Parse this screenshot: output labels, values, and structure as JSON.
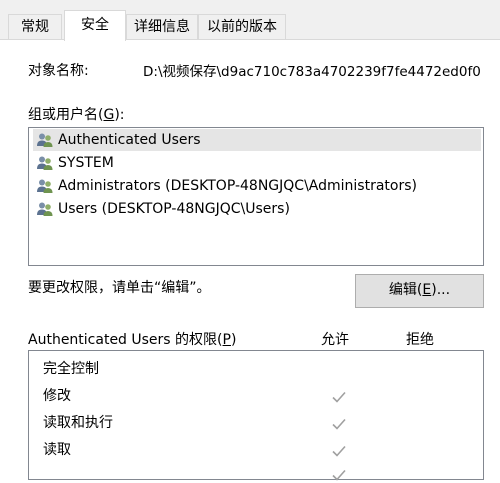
{
  "tabs": [
    {
      "label": "常规"
    },
    {
      "label": "安全"
    },
    {
      "label": "详细信息"
    },
    {
      "label": "以前的版本"
    }
  ],
  "object": {
    "label": "对象名称:",
    "value": "D:\\视频保存\\d9ac710c783a4702239f7fe4472ed0f0"
  },
  "groups": {
    "label_prefix": "组或用户名(",
    "label_key": "G",
    "label_suffix": "):",
    "items": [
      {
        "name": "Authenticated Users",
        "icon": "users-icon"
      },
      {
        "name": "SYSTEM",
        "icon": "users-icon"
      },
      {
        "name": "Administrators (DESKTOP-48NGJQC\\Administrators)",
        "icon": "users-icon"
      },
      {
        "name": "Users (DESKTOP-48NGJQC\\Users)",
        "icon": "users-icon"
      }
    ]
  },
  "change_hint": "要更改权限，请单击“编辑”。",
  "edit_button": {
    "prefix": "编辑(",
    "key": "E",
    "suffix": ")..."
  },
  "permissions": {
    "title_prefix": "Authenticated Users 的权限(",
    "title_key": "P",
    "title_suffix": ")",
    "allow_header": "允许",
    "deny_header": "拒绝",
    "rows": [
      {
        "name": "完全控制",
        "allow": false,
        "deny": false
      },
      {
        "name": "修改",
        "allow": true,
        "deny": false
      },
      {
        "name": "读取和执行",
        "allow": true,
        "deny": false
      },
      {
        "name": "读取",
        "allow": true,
        "deny": false
      }
    ]
  },
  "colors": {
    "check_gray": "#a0a0a0",
    "tabbar_bg": "#f0f0f0",
    "selected_bg": "#e5e5e5"
  }
}
